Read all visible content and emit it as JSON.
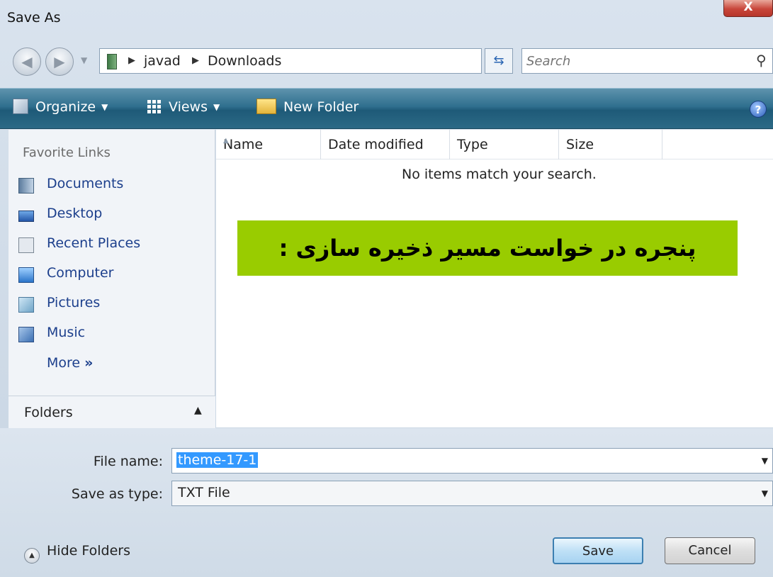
{
  "window": {
    "title": "Save As",
    "close_label": "X"
  },
  "nav": {
    "back_glyph": "◀",
    "forward_glyph": "▶",
    "breadcrumbs": [
      "javad",
      "Downloads"
    ],
    "search_placeholder": "Search"
  },
  "toolbar": {
    "organize_label": "Organize",
    "views_label": "Views",
    "new_folder_label": "New Folder",
    "help_label": "?"
  },
  "sidebar": {
    "title": "Favorite Links",
    "items": [
      {
        "label": "Documents",
        "icon": "documents-icon"
      },
      {
        "label": "Desktop",
        "icon": "desktop-icon"
      },
      {
        "label": "Recent Places",
        "icon": "recent-places-icon"
      },
      {
        "label": "Computer",
        "icon": "computer-icon"
      },
      {
        "label": "Pictures",
        "icon": "pictures-icon"
      },
      {
        "label": "Music",
        "icon": "music-icon"
      }
    ],
    "more_label": "More",
    "more_glyph": "»",
    "folders_label": "Folders"
  },
  "file_list": {
    "columns": [
      "Name",
      "Date modified",
      "Type",
      "Size"
    ],
    "empty_message": "No items match your search.",
    "caption": "پنجره  در خواست مسیر ذخیره سازی :",
    "caption_color": "#99cc00"
  },
  "form": {
    "file_name_label": "File name:",
    "file_name_value": "theme-17-1",
    "save_type_label": "Save as type:",
    "save_type_value": "TXT File",
    "hide_folders_label": "Hide Folders",
    "save_label": "Save",
    "cancel_label": "Cancel"
  }
}
